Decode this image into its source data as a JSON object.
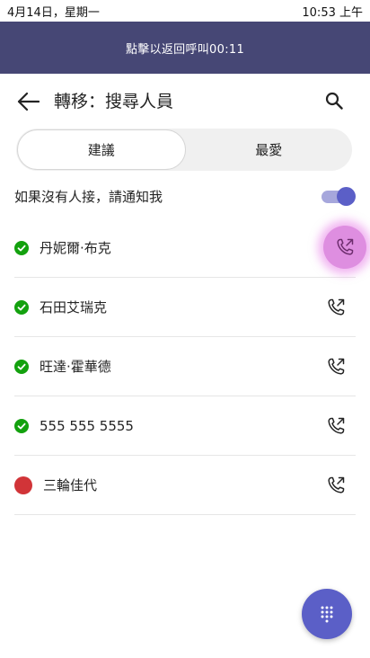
{
  "status_bar": {
    "date": "4月14日，星期一",
    "time": "10:53 上午"
  },
  "call_banner": {
    "text": "點擊以返回呼叫00:11"
  },
  "header": {
    "title": "轉移：搜尋人員"
  },
  "tabs": [
    {
      "label": "建議",
      "active": true
    },
    {
      "label": "最愛",
      "active": false
    }
  ],
  "notify": {
    "label": "如果沒有人接，請通知我",
    "enabled": true
  },
  "people": [
    {
      "name": "丹妮爾·布克",
      "status": "available"
    },
    {
      "name": "石田艾瑞克",
      "status": "available"
    },
    {
      "name": "旺達·霍華德",
      "status": "available"
    },
    {
      "name": "555 555 5555",
      "status": "available"
    },
    {
      "name": "三輪佳代",
      "status": "busy"
    }
  ],
  "colors": {
    "banner": "#464775",
    "accent": "#5b5fc7",
    "available": "#13a10e",
    "busy": "#d13438",
    "pressed": "#de8ee0"
  }
}
